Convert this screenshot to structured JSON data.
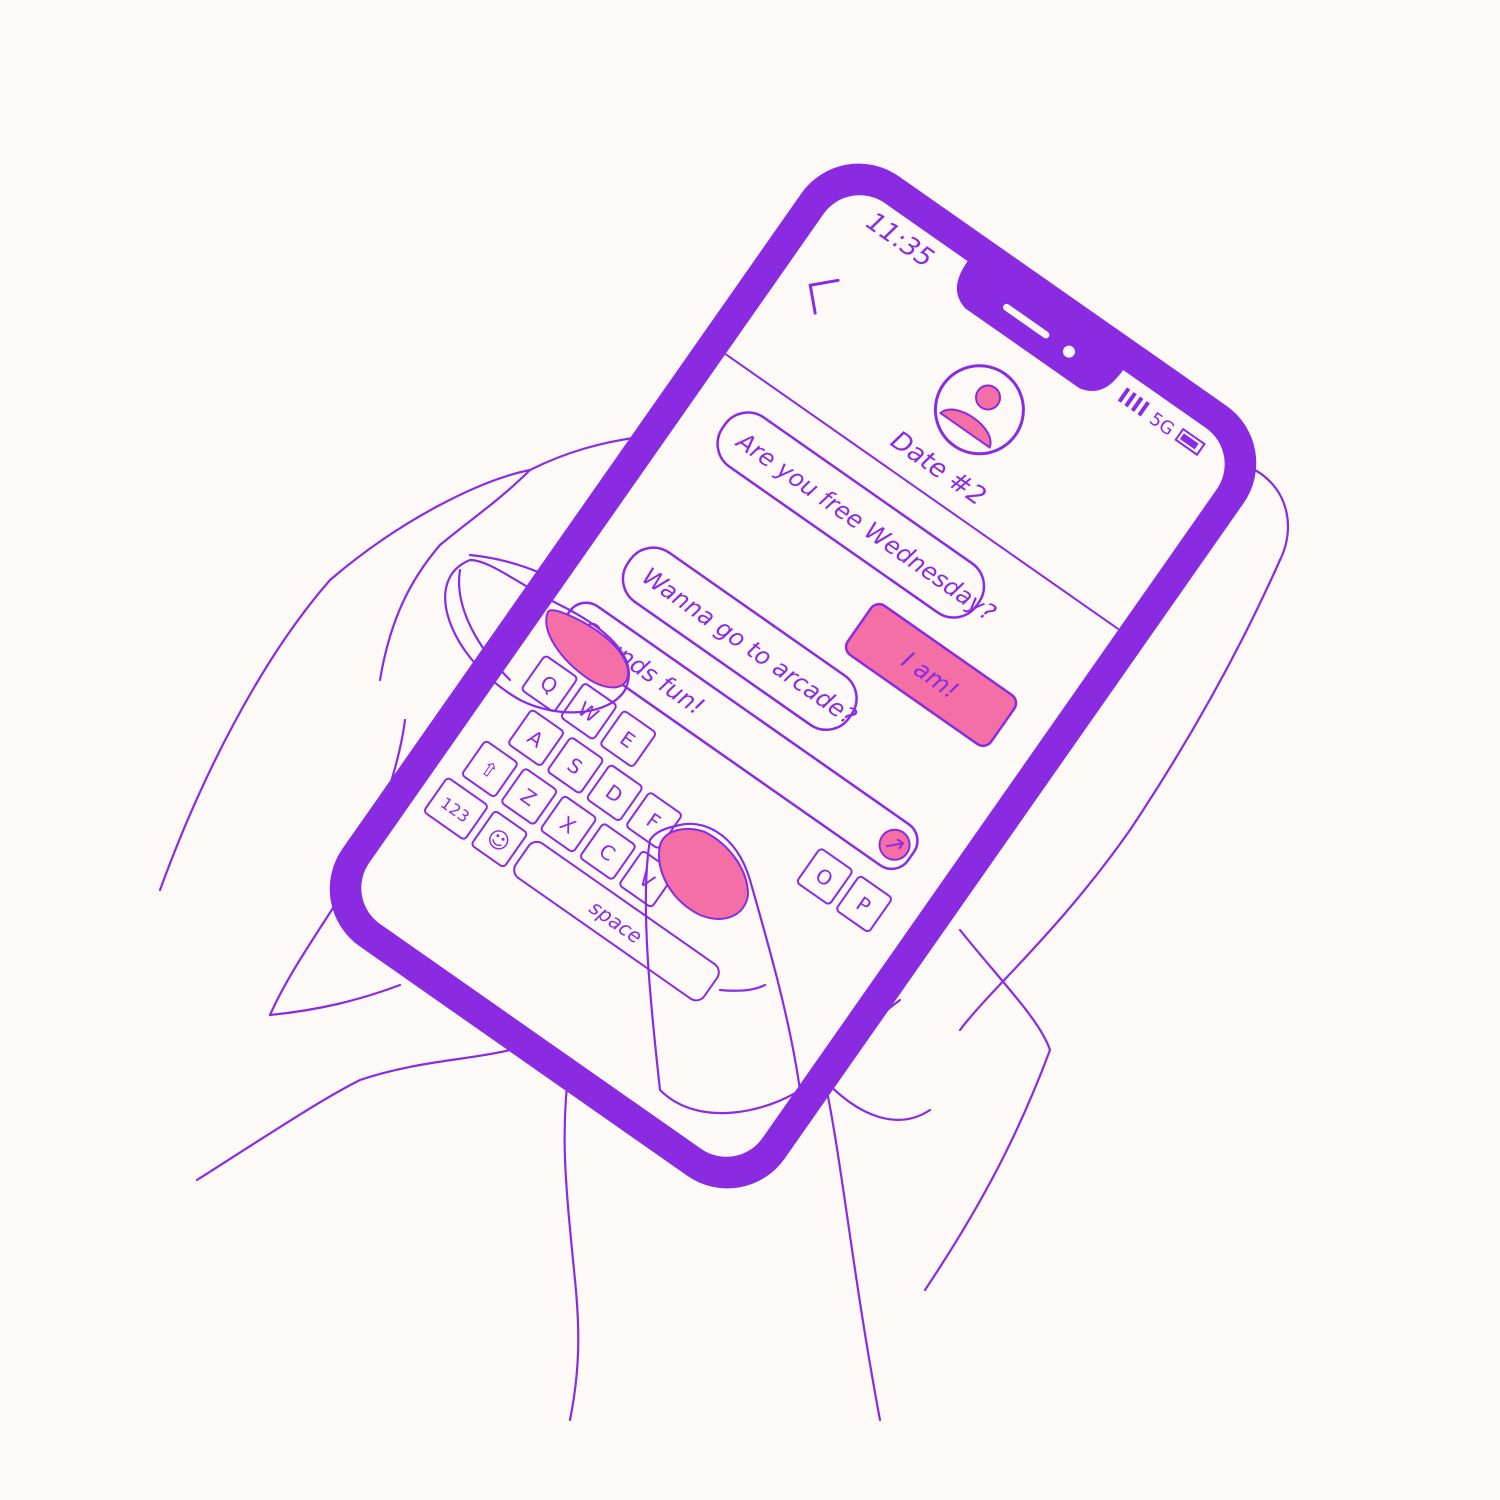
{
  "colors": {
    "phone_frame": "#8a2be2",
    "accent": "#f46fa6",
    "background": "#fdf9f6",
    "screen": "#fdf9f6"
  },
  "status_bar": {
    "time": "11:35",
    "network": "5G",
    "signal_icon": "signal-bars-icon",
    "battery_icon": "battery-icon"
  },
  "header": {
    "back_icon": "chevron-left-icon",
    "avatar_icon": "user-avatar-icon",
    "contact_name": "Date #2"
  },
  "messages": [
    {
      "sender": "them",
      "text": "Are you free Wednesday?"
    },
    {
      "sender": "me",
      "text": "I am!"
    },
    {
      "sender": "them",
      "text": "Wanna go to arcade?"
    }
  ],
  "composer": {
    "value": "Sounds fun!",
    "send_icon": "send-arrow-icon"
  },
  "keyboard": {
    "row1": [
      "Q",
      "W",
      "E",
      "O",
      "P"
    ],
    "row2": [
      "A",
      "S",
      "D",
      "F"
    ],
    "row3": [
      "⇧",
      "Z",
      "X",
      "C",
      "V"
    ],
    "row4": [
      "123",
      "☺",
      "space"
    ]
  }
}
